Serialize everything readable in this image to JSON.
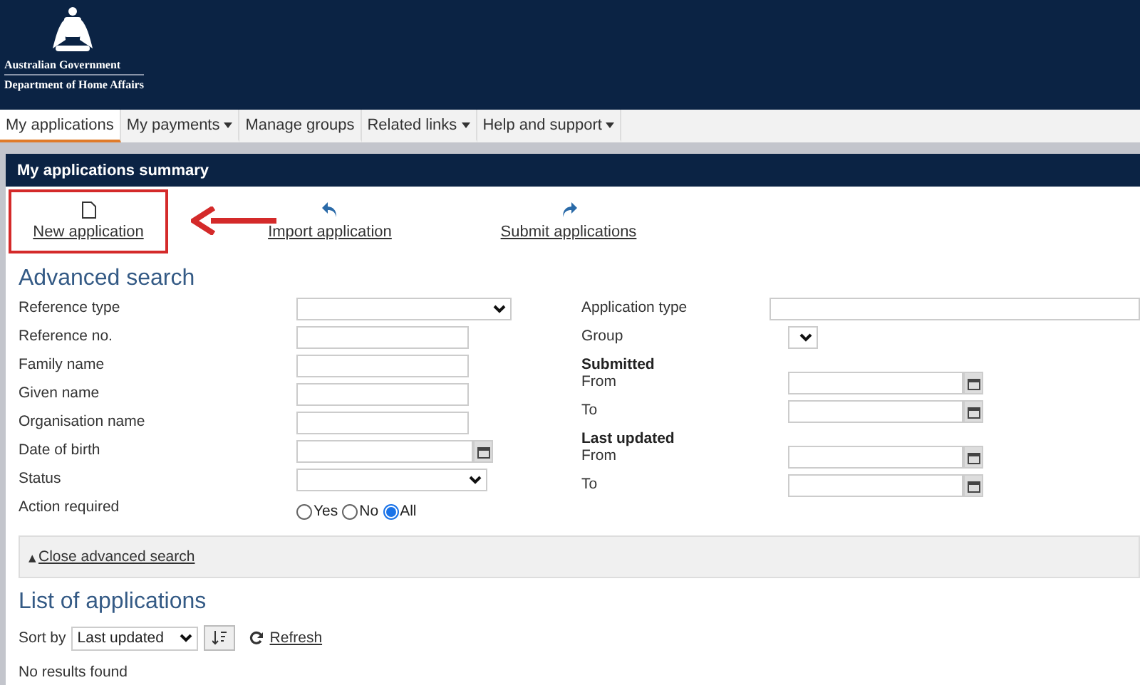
{
  "header": {
    "agency_line_1": "Australian Government",
    "agency_line_2": "Department of Home Affairs"
  },
  "nav": [
    {
      "label": "My applications",
      "selected": true,
      "dropdown": false
    },
    {
      "label": "My payments",
      "selected": false,
      "dropdown": true
    },
    {
      "label": "Manage groups",
      "selected": false,
      "dropdown": false
    },
    {
      "label": "Related links",
      "selected": false,
      "dropdown": true
    },
    {
      "label": "Help and support",
      "selected": false,
      "dropdown": true
    }
  ],
  "summary": {
    "title": "My applications summary",
    "actions": [
      {
        "label": "New application",
        "kind": "new",
        "highlighted": true
      },
      {
        "label": "Import application",
        "kind": "import",
        "highlighted": false
      },
      {
        "label": "Submit applications",
        "kind": "submit",
        "highlighted": false
      }
    ]
  },
  "advanced_search": {
    "title": "Advanced search",
    "left": [
      {
        "label": "Reference type",
        "kind": "select"
      },
      {
        "label": "Reference no.",
        "kind": "text"
      },
      {
        "label": "Family name",
        "kind": "text"
      },
      {
        "label": "Given name",
        "kind": "text"
      },
      {
        "label": "Organisation name",
        "kind": "text"
      },
      {
        "label": "Date of birth",
        "kind": "date"
      },
      {
        "label": "Status",
        "kind": "select"
      },
      {
        "label": "Action required",
        "kind": "radio",
        "options": [
          {
            "label": "Yes",
            "selected": false
          },
          {
            "label": "No",
            "selected": false
          },
          {
            "label": "All",
            "selected": true
          }
        ]
      }
    ],
    "right": [
      {
        "label": "Application type",
        "kind": "wide"
      },
      {
        "label": "Group",
        "kind": "small-select"
      },
      {
        "heading": "Submitted",
        "label": "From",
        "kind": "date"
      },
      {
        "label": "To",
        "kind": "date"
      },
      {
        "heading": "Last updated",
        "label": "From",
        "kind": "date"
      },
      {
        "label": "To",
        "kind": "date"
      }
    ],
    "close_caret": "▴",
    "close_link": "Close advanced search"
  },
  "list": {
    "title": "List of applications",
    "sort_label": "Sort by",
    "sort_value": "Last updated",
    "refresh": "Refresh",
    "empty": "No results found"
  }
}
